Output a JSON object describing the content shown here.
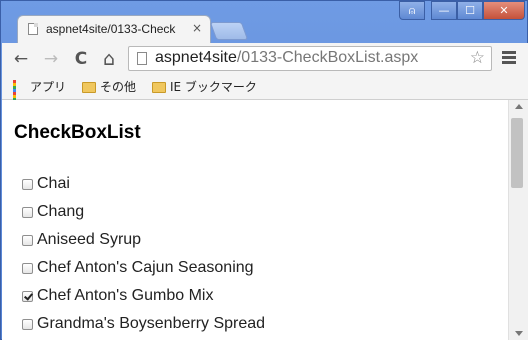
{
  "tab": {
    "title": "aspnet4site/0133-Check",
    "close": "×"
  },
  "window": {
    "user": "⍝",
    "minimize": "—",
    "maximize": "☐",
    "close": "✕"
  },
  "toolbar": {
    "back": "←",
    "forward": "→",
    "reload": "C",
    "home": "⌂",
    "star": "☆"
  },
  "address": {
    "host": "aspnet4site",
    "path": "/0133-CheckBoxList.aspx"
  },
  "bookmarks": [
    {
      "label": "アプリ",
      "icon": "apps-icon"
    },
    {
      "label": "その他",
      "icon": "folder-icon"
    },
    {
      "label": "IE ブックマーク",
      "icon": "folder-icon"
    }
  ],
  "page": {
    "heading": "CheckBoxList",
    "items": [
      {
        "label": "Chai",
        "checked": false
      },
      {
        "label": "Chang",
        "checked": false
      },
      {
        "label": "Aniseed Syrup",
        "checked": false
      },
      {
        "label": "Chef Anton's Cajun Seasoning",
        "checked": false
      },
      {
        "label": "Chef Anton's Gumbo Mix",
        "checked": true
      },
      {
        "label": "Grandma's Boysenberry Spread",
        "checked": false
      }
    ]
  },
  "colors": {
    "apps": [
      "#e94235",
      "#fbbc04",
      "#34a853",
      "#4285f4",
      "#e94235",
      "#fbbc04",
      "#34a853",
      "#4285f4",
      "#e94235"
    ]
  }
}
